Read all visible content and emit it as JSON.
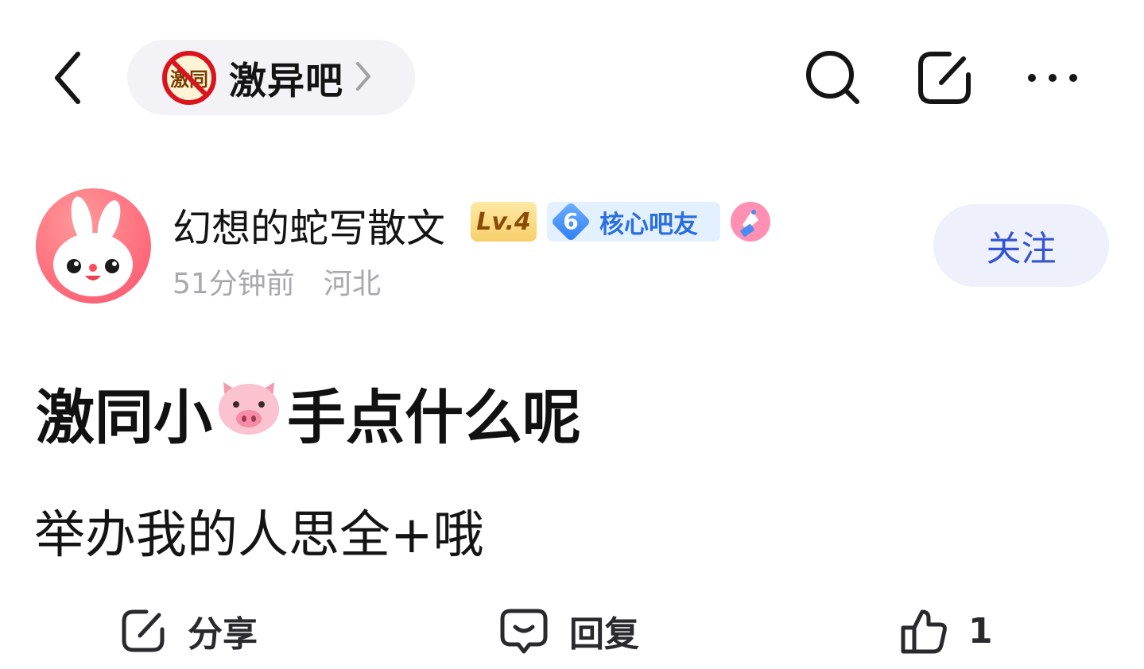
{
  "header": {
    "forum_logo_text": "激同",
    "forum_name": "激异吧"
  },
  "author": {
    "name": "幻想的蛇写散文",
    "level_badge": "Lv.4",
    "fan_level": "6",
    "fan_title": "核心吧友",
    "time": "51分钟前",
    "location": "河北",
    "follow_label": "关注"
  },
  "post": {
    "title_before": "激同小",
    "title_after": "手点什么呢",
    "body": "举办我的人思全+哦"
  },
  "actions": {
    "share_label": "分享",
    "reply_label": "回复",
    "like_count": "1"
  },
  "colors": {
    "accent": "#3455d1",
    "pill_bg": "#f3f3f7",
    "follow_bg": "#eef0fb",
    "meta_gray": "#a8a8ad"
  }
}
